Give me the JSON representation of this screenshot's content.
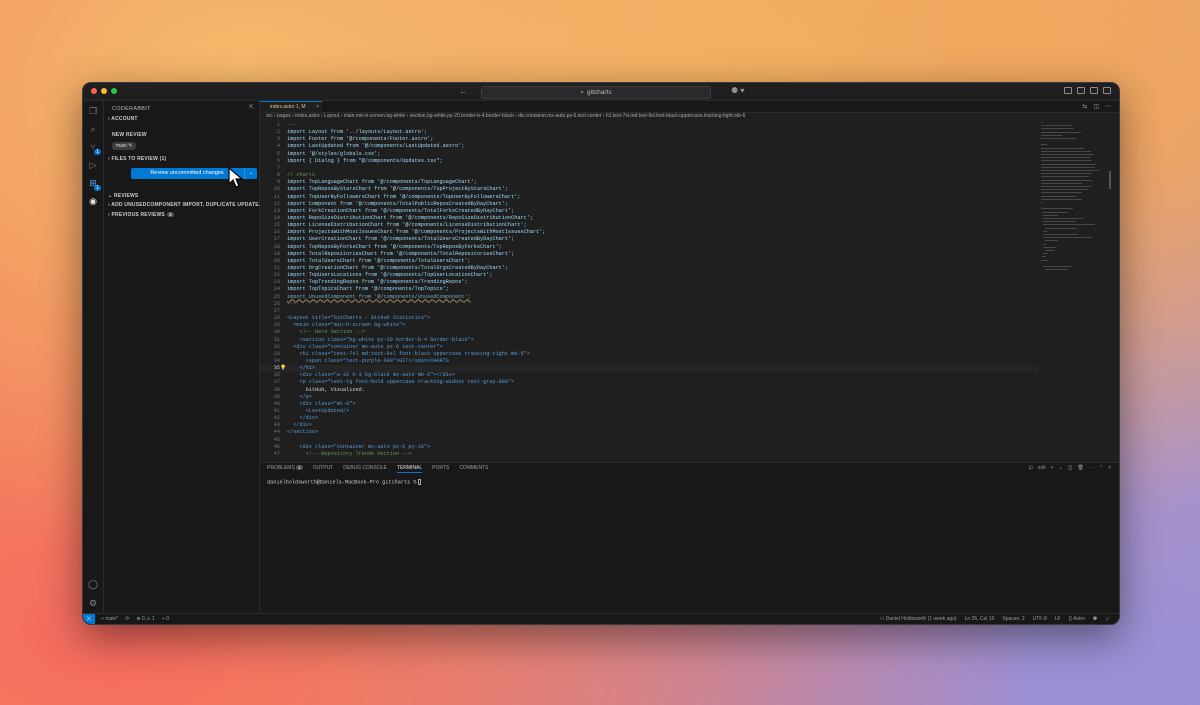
{
  "titlebar": {
    "search_text": "gitcharts",
    "copilot_icon": "copilot-icon",
    "traffic_colors": [
      "#ff5f57",
      "#febc2e",
      "#28c840"
    ]
  },
  "activity_bar": {
    "source_control_badge": "1",
    "extensions_badge": "1"
  },
  "sidebar": {
    "title": "CODERABBIT",
    "account": "ACCOUNT",
    "new_review": "NEW REVIEW",
    "branch_chip": "main",
    "files_to_review": "FILES TO REVIEW (1)",
    "review_button": "Review uncommitted changes",
    "reviews": "REVIEWS",
    "review_item": "ADD UNUSEDCOMPONENT IMPORT, DUPLICATE UPDATE...",
    "previous_reviews": "PREVIOUS REVIEWS",
    "previous_count": "3"
  },
  "editor": {
    "tab_label": "index.astro",
    "tab_status": "1, M",
    "breadcrumb": [
      "src",
      "pages",
      "index.astro",
      "Layout",
      "main.min-h-screen.bg-white",
      "section.bg-white.py-20.border-b-4.border-black",
      "div.container.mx-auto.px-6.text-center",
      "h1.text-7xl.md:text-9xl.font-black.uppercase.tracking-tight.mb-6"
    ],
    "lines": [
      {
        "n": "1",
        "t": "---"
      },
      {
        "n": "2",
        "t": "import Layout from '../layouts/Layout.astro';"
      },
      {
        "n": "3",
        "t": "import Footer from '@/components/Footer.astro';"
      },
      {
        "n": "4",
        "t": "import LastUpdated from '@/components/LastUpdated.astro';"
      },
      {
        "n": "5",
        "t": "import '@/styles/globals.css';"
      },
      {
        "n": "6",
        "t": "import { Dialog } from \"@/components/Updates.tsx\";"
      },
      {
        "n": "7",
        "t": ""
      },
      {
        "n": "8",
        "t": "// charts"
      },
      {
        "n": "9",
        "t": "import TopLanguageChart from '@/components/TopLanguageChart';"
      },
      {
        "n": "10",
        "t": "import TopReposByStarsChart from '@/components/TopProjectByStarsChart';"
      },
      {
        "n": "11",
        "t": "import TopUserByFollowersChart from '@/components/TopUserByFollowersChart';"
      },
      {
        "n": "12",
        "t": "import Component from '@/components/TotalPublicReposCreatedByDayChart';"
      },
      {
        "n": "13",
        "t": "import ForkCreationChart from '@/components/TotalForksCreatedByDayChart';"
      },
      {
        "n": "14",
        "t": "import RepoSizeDistributionChart from '@/components/RepoSizeDistributionChart';"
      },
      {
        "n": "15",
        "t": "import LicenseDistributionChart from '@/components/LicenseDistributionChart';"
      },
      {
        "n": "16",
        "t": "import ProjectsWithMostIssuesChart from '@/components/ProjectsWithMostIssuesChart';"
      },
      {
        "n": "17",
        "t": "import UserCreationChart from '@/components/TotalUsersCreatedByDayChart';"
      },
      {
        "n": "18",
        "t": "import TopReposByForksChart from '@/components/TopReposByForksChart';"
      },
      {
        "n": "19",
        "t": "import TotalRepositoriesChart from '@/components/TotalRepositoriesChart';"
      },
      {
        "n": "20",
        "t": "import TotalUsersChart from '@/components/TotalUsersChart';"
      },
      {
        "n": "21",
        "t": "import OrgCreationChart from '@/components/TotalOrgsCreatedByDayChart';"
      },
      {
        "n": "22",
        "t": "import TopUsersLocations from '@/components/TopUserLocationChart';"
      },
      {
        "n": "23",
        "t": "import TopTrendingRepos from '@/components/TrendingRepos';"
      },
      {
        "n": "24",
        "t": "import TopTopicsChart from '@/components/TopTopics';"
      },
      {
        "n": "25",
        "t": "import UnusedComponent from '@/components/UnusedComponent';"
      },
      {
        "n": "26",
        "t": "---"
      },
      {
        "n": "27",
        "t": ""
      },
      {
        "n": "28",
        "t": "<Layout title=\"GitCharts - GitHub Statistics\">"
      },
      {
        "n": "29",
        "t": "  <main class=\"min-h-screen bg-white\">"
      },
      {
        "n": "30",
        "t": "    <!-- Hero Section -->"
      },
      {
        "n": "31",
        "t": "    <section class=\"bg-white py-20 border-b-4 border-black\">"
      },
      {
        "n": "32",
        "t": "  <div class=\"container mx-auto px-6 text-center\">"
      },
      {
        "n": "33",
        "t": "    <h1 class=\"text-7xl md:text-9xl font-black uppercase tracking-tight mb-6\">"
      },
      {
        "n": "34",
        "t": "      <span class=\"text-purple-600\">GIT</span>CHARTS"
      },
      {
        "n": "35",
        "t": "    </h1>"
      },
      {
        "n": "36",
        "t": "    <div class=\"w-32 h-3 bg-black mx-auto mb-6\"></div>"
      },
      {
        "n": "37",
        "t": "    <p class=\"text-lg font-bold uppercase tracking-widest text-gray-800\">"
      },
      {
        "n": "38",
        "t": "      GitHub, Visualized."
      },
      {
        "n": "39",
        "t": "    </p>"
      },
      {
        "n": "40",
        "t": "    <div class=\"mt-8\">"
      },
      {
        "n": "41",
        "t": "      <LastUpdated/>"
      },
      {
        "n": "42",
        "t": "    </div>"
      },
      {
        "n": "43",
        "t": "  </div>"
      },
      {
        "n": "44",
        "t": "</section>"
      },
      {
        "n": "45",
        "t": ""
      },
      {
        "n": "46",
        "t": "    <div class=\"container mx-auto px-6 py-16\">"
      },
      {
        "n": "47",
        "t": "      <!-- Repository Trends Section -->"
      }
    ]
  },
  "panel": {
    "tabs": [
      "PROBLEMS",
      "OUTPUT",
      "DEBUG CONSOLE",
      "TERMINAL",
      "PORTS",
      "COMMENTS"
    ],
    "problems_count": "1",
    "active_tab": "TERMINAL",
    "terminal_name": "zsh",
    "prompt": "danielholdsworth@Daniels-MacBook-Pro gitcharts %"
  },
  "status": {
    "branch": "main*",
    "errors": "0",
    "warnings": "1",
    "ports": "0",
    "blame": "Daniel Holdsworth (1 week ago)",
    "position": "Ln 35, Col 10",
    "spaces": "Spaces: 2",
    "encoding": "UTF-8",
    "eol": "LF",
    "language": "Astro"
  }
}
